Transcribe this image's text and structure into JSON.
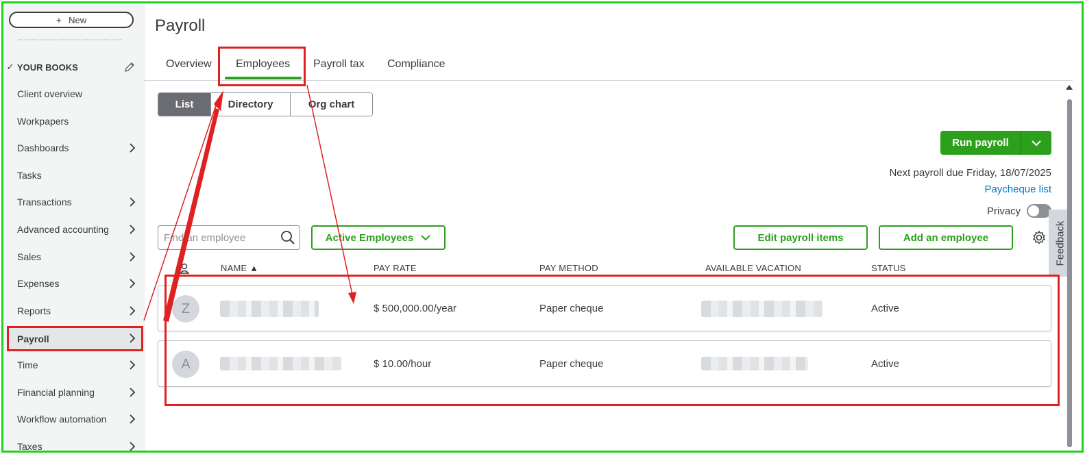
{
  "sidebar": {
    "new_label": "New",
    "books_label": "YOUR BOOKS",
    "items": [
      {
        "label": "Client overview",
        "chevron": false
      },
      {
        "label": "Workpapers",
        "chevron": false
      },
      {
        "label": "Dashboards",
        "chevron": true
      },
      {
        "label": "Tasks",
        "chevron": false
      },
      {
        "label": "Transactions",
        "chevron": true
      },
      {
        "label": "Advanced accounting",
        "chevron": true
      },
      {
        "label": "Sales",
        "chevron": true
      },
      {
        "label": "Expenses",
        "chevron": true
      },
      {
        "label": "Reports",
        "chevron": true
      },
      {
        "label": "Payroll",
        "chevron": true,
        "active": true
      },
      {
        "label": "Time",
        "chevron": true
      },
      {
        "label": "Financial planning",
        "chevron": true
      },
      {
        "label": "Workflow automation",
        "chevron": true
      },
      {
        "label": "Taxes",
        "chevron": true
      }
    ]
  },
  "page": {
    "title": "Payroll",
    "tabs": [
      "Overview",
      "Employees",
      "Payroll tax",
      "Compliance"
    ],
    "active_tab": "Employees",
    "views": [
      "List",
      "Directory",
      "Org chart"
    ]
  },
  "actions": {
    "run_payroll": "Run payroll",
    "next_due": "Next payroll due Friday, 18/07/2025",
    "paycheque_list": "Paycheque list",
    "privacy": "Privacy",
    "feedback": "Feedback",
    "search_placeholder": "Find an employee",
    "filter": "Active Employees",
    "edit_payroll_items": "Edit payroll items",
    "add_employee": "Add an employee"
  },
  "table": {
    "headers": {
      "name": "NAME ▲",
      "pay_rate": "PAY RATE",
      "pay_method": "PAY METHOD",
      "vacation": "AVAILABLE VACATION",
      "status": "STATUS"
    },
    "rows": [
      {
        "initial": "Z",
        "pay_rate": "$ 500,000.00/year",
        "pay_method": "Paper cheque",
        "status": "Active"
      },
      {
        "initial": "A",
        "pay_rate": "$ 10.00/hour",
        "pay_method": "Paper cheque",
        "status": "Active"
      }
    ]
  },
  "colors": {
    "brand_green": "#2ca01c",
    "link_blue": "#0077c5",
    "annotation_red": "#e02121",
    "frame_green": "#22d11e"
  }
}
